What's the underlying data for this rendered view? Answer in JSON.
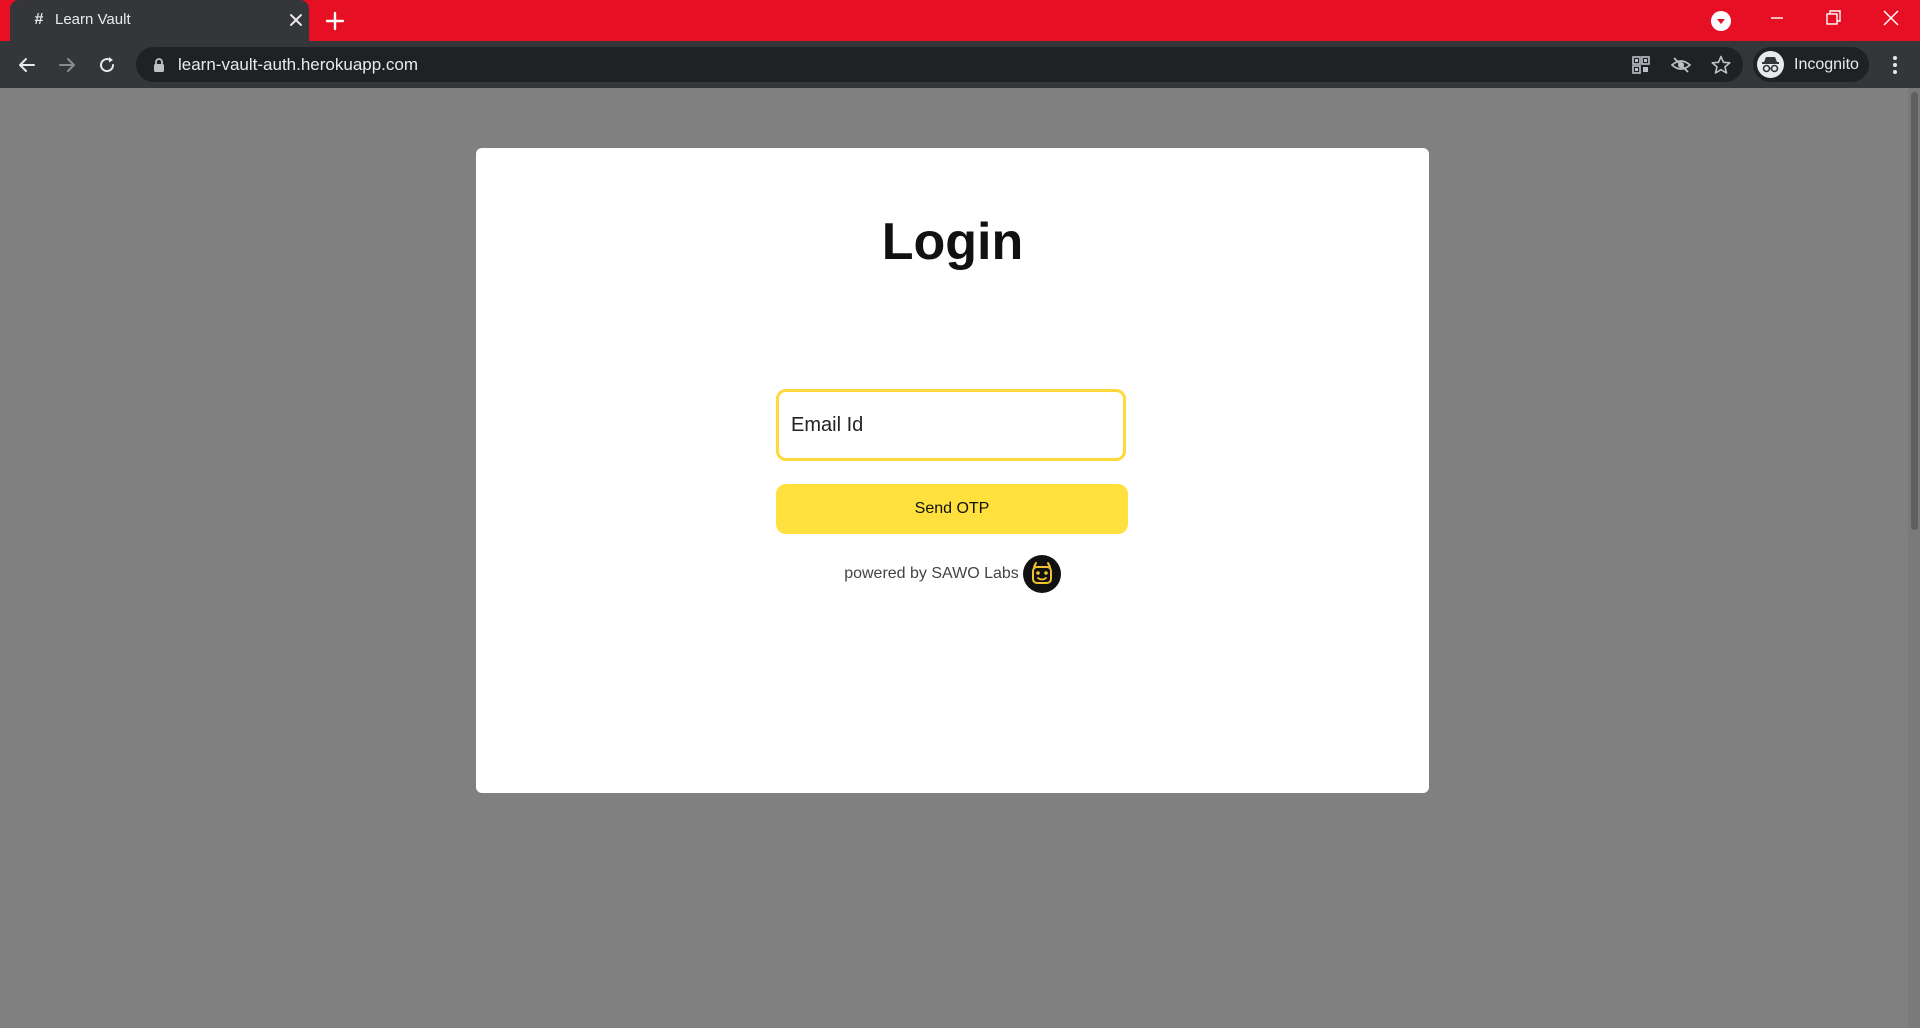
{
  "browser": {
    "tab": {
      "title": "Learn Vault",
      "favicon": "hash-icon"
    },
    "address": {
      "url": "learn-vault-auth.herokuapp.com"
    },
    "profile": {
      "label": "Incognito"
    },
    "colors": {
      "titlebar": "#e60f23",
      "toolbar": "#35363a"
    }
  },
  "page": {
    "background": "#808080",
    "login": {
      "title": "Login",
      "email_placeholder": "Email Id",
      "send_button": "Send OTP",
      "powered_by": "powered by SAWO Labs",
      "accent": "#ffe03d"
    }
  }
}
